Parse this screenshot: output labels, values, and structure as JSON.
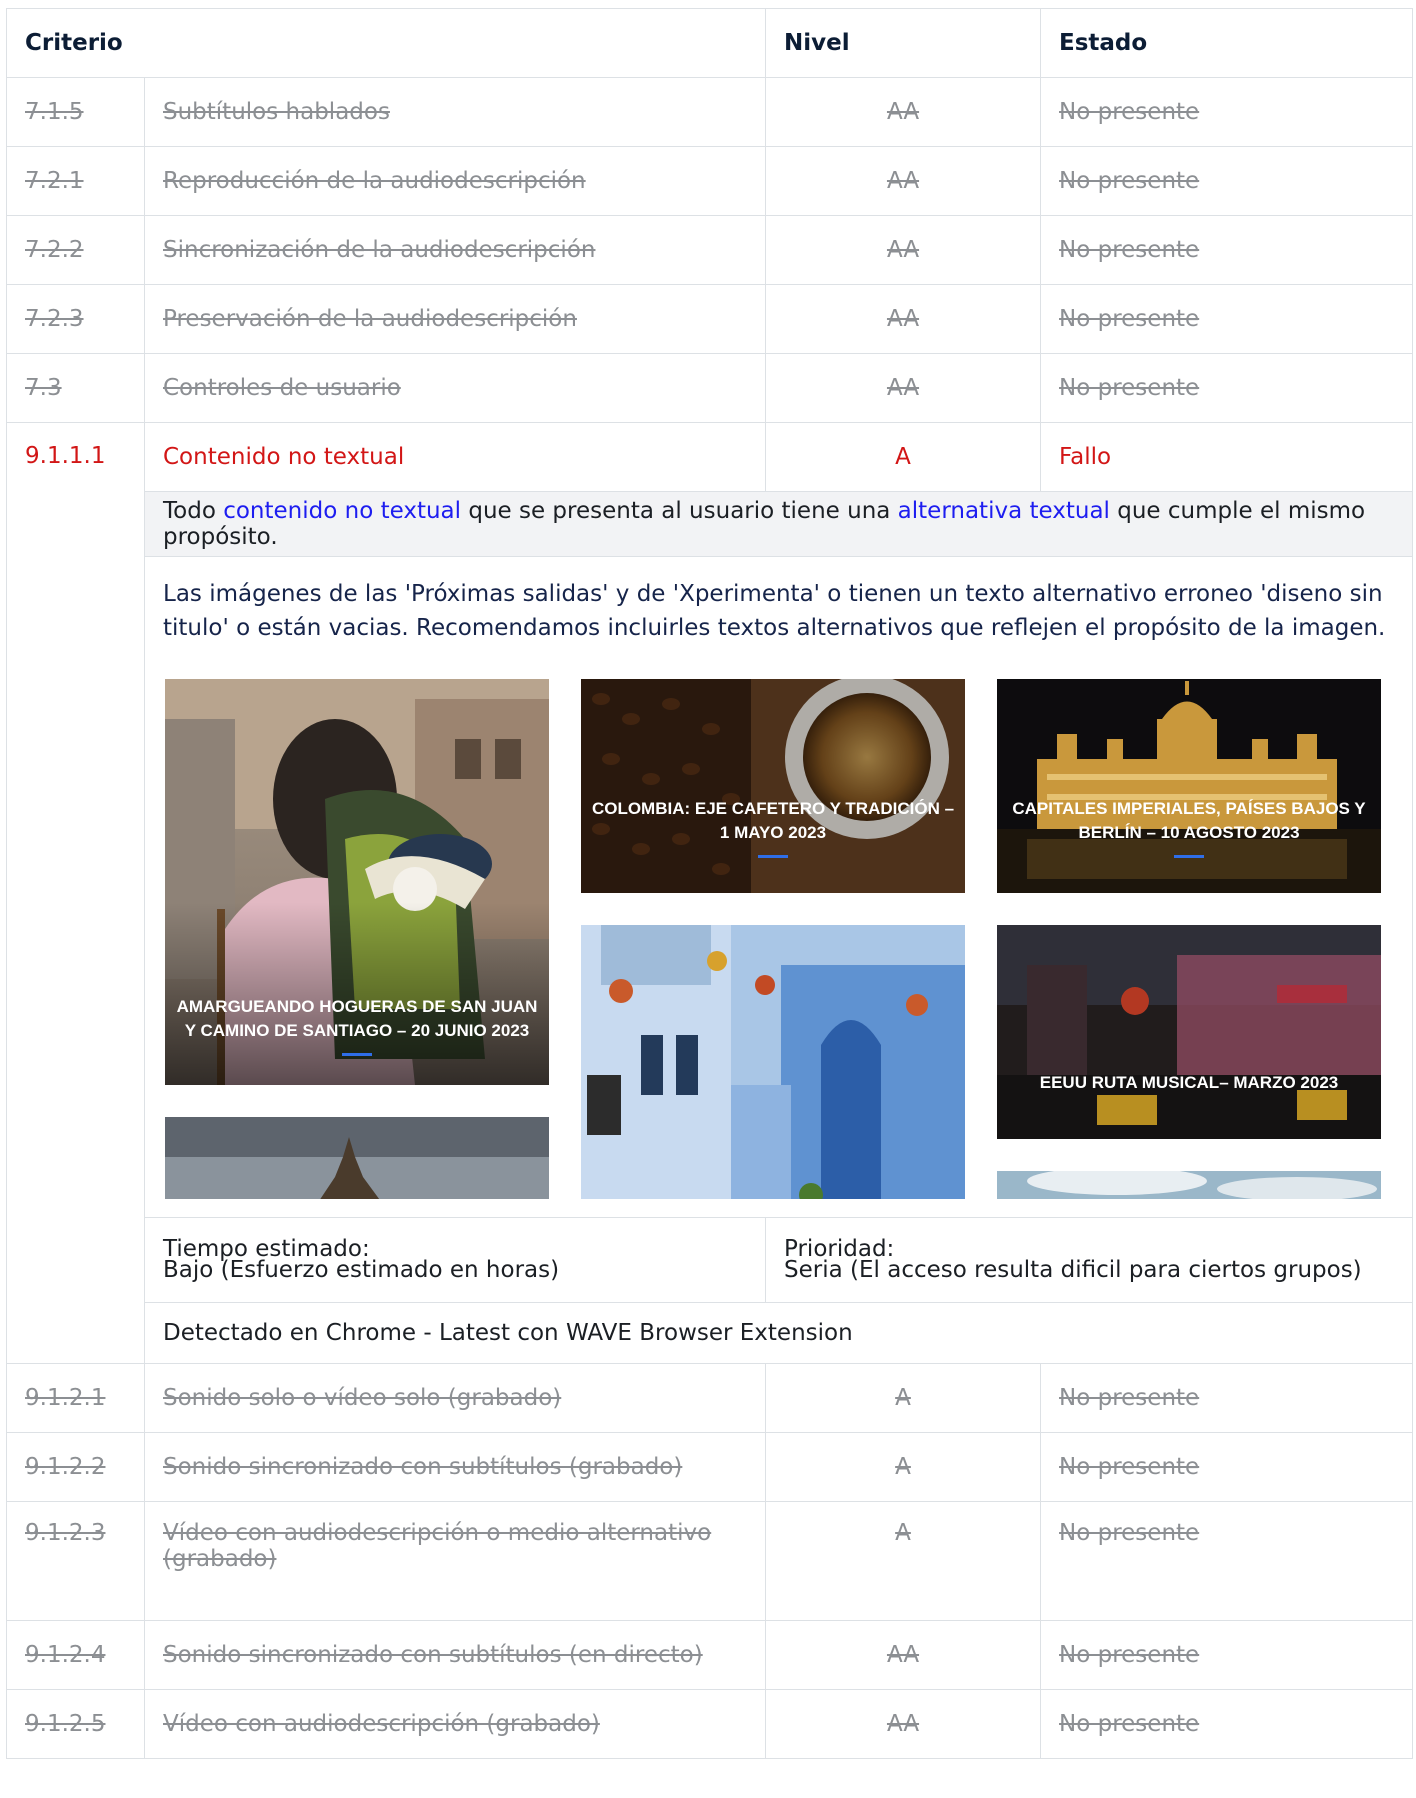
{
  "header": {
    "criterio": "Criterio",
    "nivel": "Nivel",
    "estado": "Estado"
  },
  "rows_before": [
    {
      "id": "7.1.5",
      "name": "Subtítulos hablados",
      "level": "AA",
      "status": "No presente"
    },
    {
      "id": "7.2.1",
      "name": "Reproducción de la audiodescripción",
      "level": "AA",
      "status": "No presente"
    },
    {
      "id": "7.2.2",
      "name": "Sincronización de la audiodescripción",
      "level": "AA",
      "status": "No presente"
    },
    {
      "id": "7.2.3",
      "name": "Preservación de la audiodescripción",
      "level": "AA",
      "status": "No presente"
    },
    {
      "id": "7.3",
      "name": "Controles de usuario",
      "level": "AA",
      "status": "No presente"
    }
  ],
  "fail_row": {
    "id": "9.1.1.1",
    "name": "Contenido no textual",
    "level": "A",
    "status": "Fallo"
  },
  "description": {
    "t1": "Todo ",
    "link1": "contenido no textual",
    "t2": " que se presenta al usuario tiene una ",
    "link2": "alternativa textual",
    "t3": " que cumple el mismo propósito."
  },
  "finding": "Las imágenes de las 'Próximas salidas' y de 'Xperimenta' o tienen un texto alternativo erroneo 'diseno sin titulo' o están vacias. Recomendamos incluirles textos alternativos que reflejen el propósito de la imagen.",
  "gallery": [
    {
      "caption": "AMARGUEANDO HOGUERAS DE SAN JUAN Y CAMINO DE SANTIAGO – 20 JUNIO 2023"
    },
    {
      "caption": "COLOMBIA: EJE CAFETERO Y TRADICIÓN – 1 MAYO 2023"
    },
    {
      "caption": "CAPITALES IMPERIALES, PAÍSES BAJOS Y BERLÍN – 10 AGOSTO 2023"
    },
    {
      "caption": "EEUU RUTA MUSICAL– MARZO 2023"
    }
  ],
  "meta": {
    "tiempo_label": "Tiempo estimado:",
    "tiempo_value": "Bajo (Esfuerzo estimado en horas)",
    "prioridad_label": "Prioridad:",
    "prioridad_value": "Seria (El acceso resulta dificil para ciertos grupos)",
    "detectado": "Detectado en Chrome - Latest con WAVE Browser Extension"
  },
  "rows_after": [
    {
      "id": "9.1.2.1",
      "name": "Sonido solo o vídeo solo (grabado)",
      "level": "A",
      "status": "No presente"
    },
    {
      "id": "9.1.2.2",
      "name": "Sonido sincronizado con subtítulos (grabado)",
      "level": "A",
      "status": "No presente"
    },
    {
      "id": "9.1.2.3",
      "name": "Vídeo con audiodescripción o medio alternativo (grabado)",
      "level": "A",
      "status": "No presente"
    },
    {
      "id": "9.1.2.4",
      "name": "Sonido sincronizado con subtítulos (en directo)",
      "level": "AA",
      "status": "No presente"
    },
    {
      "id": "9.1.2.5",
      "name": "Vídeo con audiodescripción (grabado)",
      "level": "AA",
      "status": "No presente"
    }
  ]
}
